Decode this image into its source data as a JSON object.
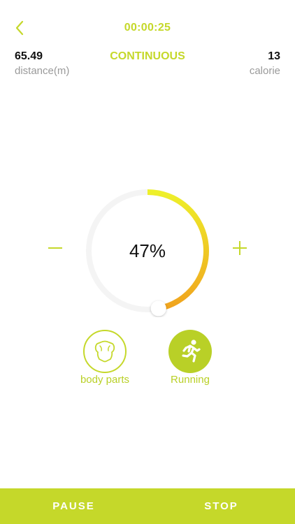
{
  "header": {
    "timer": "00:00:25",
    "mode": "CONTINUOUS"
  },
  "stats": {
    "distance_value": "65.49",
    "distance_label": "distance(m)",
    "calorie_value": "13",
    "calorie_label": "calorie"
  },
  "dial": {
    "percent_text": "47%",
    "percent_value": 0.47
  },
  "modes": {
    "body_parts_label": "body parts",
    "running_label": "Running"
  },
  "actions": {
    "pause_label": "PAUSE",
    "stop_label": "STOP"
  },
  "icons": {
    "back": "chevron-left-icon",
    "minus": "minus-icon",
    "plus": "plus-icon",
    "body_parts": "body-parts-icon",
    "running": "running-person-icon"
  },
  "colors": {
    "accent": "#c5d82a",
    "accent_dark": "#b9d027",
    "gauge_start": "#eef02a",
    "gauge_end": "#f0a31e",
    "track": "#f4f4f4"
  }
}
